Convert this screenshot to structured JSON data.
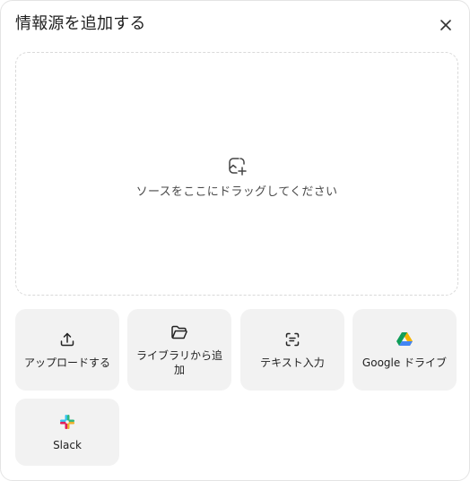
{
  "dialog": {
    "title": "情報源を追加する",
    "close_icon": "close-icon"
  },
  "dropzone": {
    "icon": "add-image-icon",
    "text": "ソースをここにドラッグしてください"
  },
  "sources": [
    {
      "label": "アップロードする",
      "icon": "upload-icon"
    },
    {
      "label": "ライブラリから追加",
      "icon": "folder-icon"
    },
    {
      "label": "テキスト入力",
      "icon": "text-scan-icon"
    },
    {
      "label": "Google ドライブ",
      "icon": "google-drive-icon"
    },
    {
      "label": "Slack",
      "icon": "slack-icon"
    }
  ],
  "colors": {
    "card_background": "#f2f2f2",
    "dashed_border": "#d9d9d9",
    "text": "#1f1f1f",
    "drive_green": "#0f9d58",
    "drive_blue": "#4285f4",
    "drive_yellow": "#f4b400",
    "slack_red": "#e01e5a",
    "slack_green": "#2eb67d",
    "slack_blue": "#36c5f0",
    "slack_yellow": "#ecb22e"
  }
}
